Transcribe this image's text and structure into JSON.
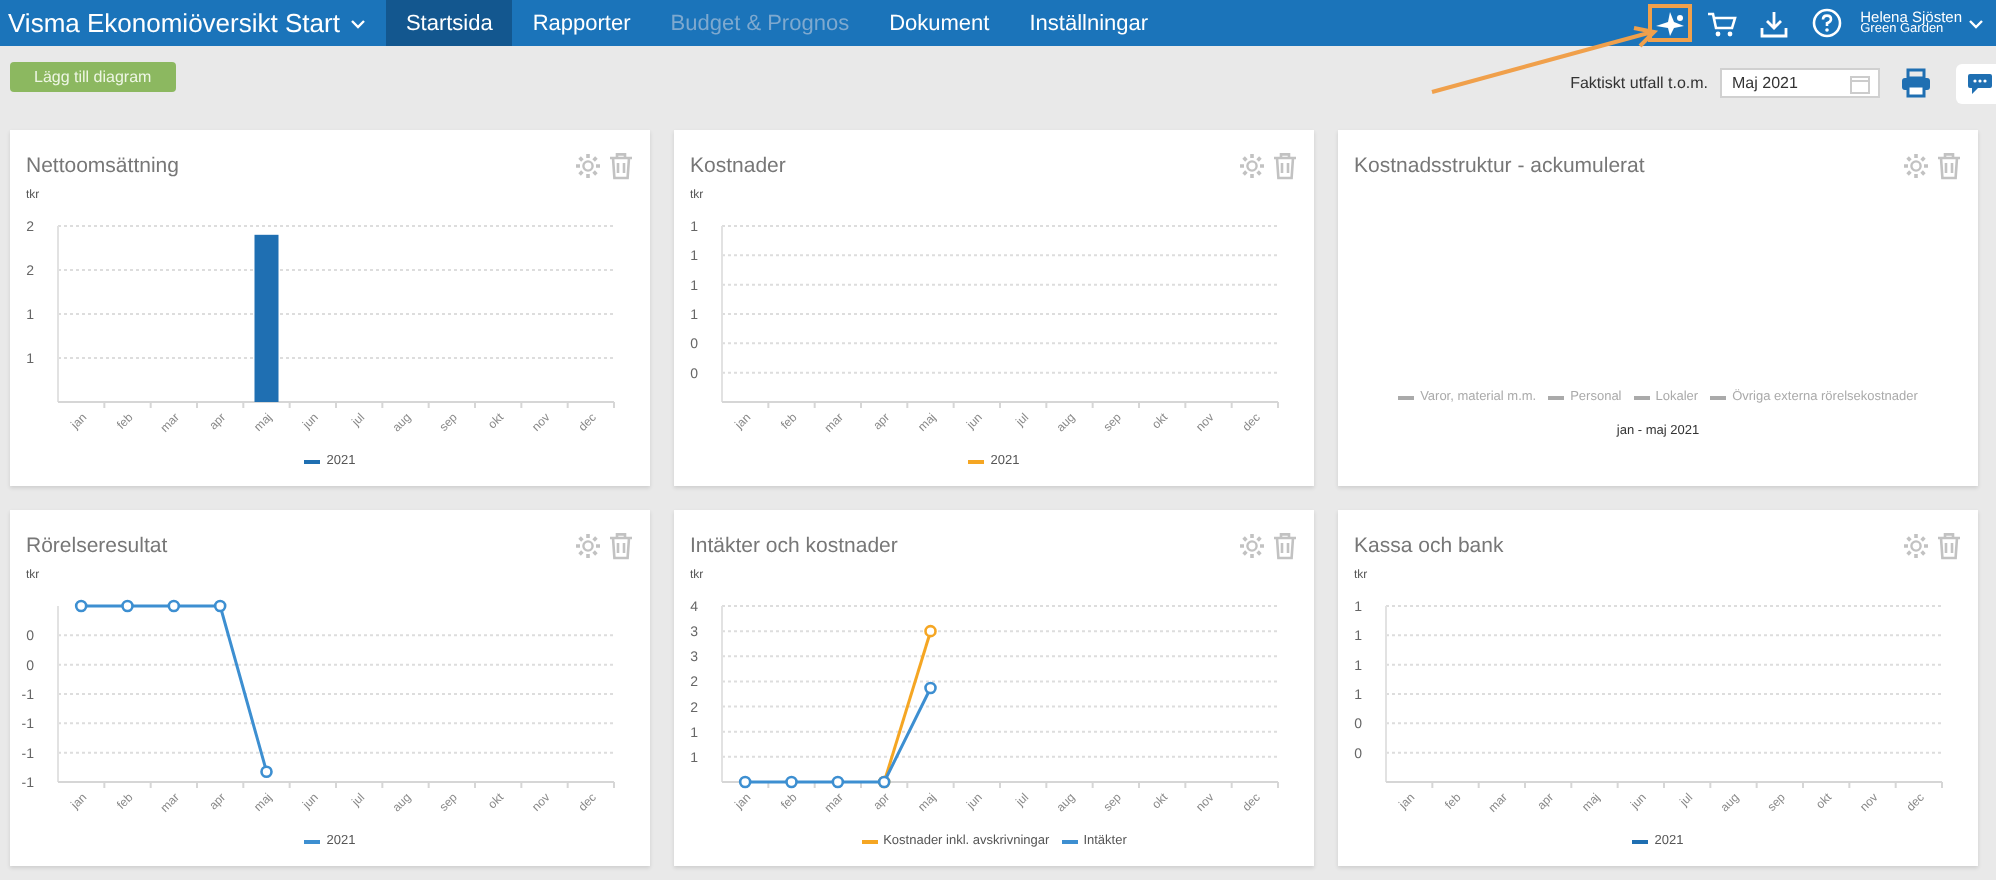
{
  "header": {
    "app_title": "Visma Ekonomiöversikt Start",
    "tabs": [
      {
        "label": "Startsida",
        "selected": true,
        "disabled": false
      },
      {
        "label": "Rapporter",
        "selected": false,
        "disabled": false
      },
      {
        "label": "Budget & Prognos",
        "selected": false,
        "disabled": true
      },
      {
        "label": "Dokument",
        "selected": false,
        "disabled": false
      },
      {
        "label": "Inställningar",
        "selected": false,
        "disabled": false
      }
    ],
    "icons": [
      {
        "kind": "tour",
        "highlighted": true
      },
      {
        "kind": "cart",
        "highlighted": false
      },
      {
        "kind": "download",
        "highlighted": false
      },
      {
        "kind": "help",
        "highlighted": false
      }
    ],
    "user": {
      "name": "Helena Sjösten",
      "company": "Green Garden"
    }
  },
  "toolbar": {
    "add_button": "Lägg till diagram",
    "period_label": "Faktiskt utfall t.o.m.",
    "period_value": "Maj 2021"
  },
  "cards": [
    {
      "title": "Nettoomsättning",
      "kind": "chart",
      "chart_data": {
        "type": "bar",
        "grid": true,
        "ylabel": "tkr",
        "categories": [
          "jan",
          "feb",
          "mar",
          "apr",
          "maj",
          "jun",
          "jul",
          "aug",
          "sep",
          "okt",
          "nov",
          "dec"
        ],
        "ylim": [
          0,
          2
        ],
        "yticks": [
          {
            "value": 0.5,
            "label": "1"
          },
          {
            "value": 1,
            "label": "1"
          },
          {
            "value": 1.5,
            "label": "2"
          },
          {
            "value": 2,
            "label": "2"
          }
        ],
        "series": [
          {
            "name": "2021",
            "color": "#1f6fb2",
            "values": [
              null,
              null,
              null,
              null,
              1.9,
              null,
              null,
              null,
              null,
              null,
              null,
              null
            ]
          }
        ]
      }
    },
    {
      "title": "Kostnader",
      "kind": "chart",
      "chart_data": {
        "type": "line",
        "grid": true,
        "ylabel": "tkr",
        "categories": [
          "jan",
          "feb",
          "mar",
          "apr",
          "maj",
          "jun",
          "jul",
          "aug",
          "sep",
          "okt",
          "nov",
          "dec"
        ],
        "ylim": [
          0,
          1.2
        ],
        "yticks": [
          {
            "value": 0.2,
            "label": "0"
          },
          {
            "value": 0.4,
            "label": "0"
          },
          {
            "value": 0.6,
            "label": "1"
          },
          {
            "value": 0.8,
            "label": "1"
          },
          {
            "value": 1,
            "label": "1"
          },
          {
            "value": 1.2,
            "label": "1"
          }
        ],
        "series": [
          {
            "name": "2021",
            "color": "#f5a623",
            "values": [
              null,
              null,
              null,
              null,
              null,
              null,
              null,
              null,
              null,
              null,
              null,
              null
            ]
          }
        ]
      }
    },
    {
      "title": "Kostnadsstruktur - ackumulerat",
      "kind": "legend_only",
      "legend": [
        "Varor, material m.m.",
        "Personal",
        "Lokaler",
        "Övriga externa rörelsekostnader"
      ],
      "period": "jan - maj 2021"
    },
    {
      "title": "Rörelseresultat",
      "kind": "chart",
      "chart_data": {
        "type": "line",
        "grid": true,
        "ylabel": "tkr",
        "categories": [
          "jan",
          "feb",
          "mar",
          "apr",
          "maj",
          "jun",
          "jul",
          "aug",
          "sep",
          "okt",
          "nov",
          "dec"
        ],
        "ylim": [
          -1.2,
          0
        ],
        "yticks": [
          {
            "value": -1.2,
            "label": "-1"
          },
          {
            "value": -1,
            "label": "-1"
          },
          {
            "value": -0.8,
            "label": "-1"
          },
          {
            "value": -0.6,
            "label": "-1"
          },
          {
            "value": -0.4,
            "label": "0"
          },
          {
            "value": -0.2,
            "label": "0"
          }
        ],
        "series": [
          {
            "name": "2021",
            "color": "#3d8fd1",
            "marker": true,
            "values": [
              0,
              0,
              0,
              0,
              -1.13,
              null,
              null,
              null,
              null,
              null,
              null,
              null
            ]
          }
        ]
      }
    },
    {
      "title": "Intäkter och kostnader",
      "kind": "chart",
      "chart_data": {
        "type": "line",
        "grid": true,
        "ylabel": "tkr",
        "categories": [
          "jan",
          "feb",
          "mar",
          "apr",
          "maj",
          "jun",
          "jul",
          "aug",
          "sep",
          "okt",
          "nov",
          "dec"
        ],
        "ylim": [
          0,
          3.5
        ],
        "yticks": [
          {
            "value": 0.5,
            "label": "1"
          },
          {
            "value": 1,
            "label": "1"
          },
          {
            "value": 1.5,
            "label": "2"
          },
          {
            "value": 2,
            "label": "2"
          },
          {
            "value": 2.5,
            "label": "3"
          },
          {
            "value": 3,
            "label": "3"
          },
          {
            "value": 3.5,
            "label": "4"
          }
        ],
        "series": [
          {
            "name": "Kostnader inkl. avskrivningar",
            "color": "#f5a623",
            "marker": true,
            "values": [
              null,
              null,
              null,
              0,
              3,
              null,
              null,
              null,
              null,
              null,
              null,
              null
            ]
          },
          {
            "name": "Intäkter",
            "color": "#3d8fd1",
            "marker": true,
            "values": [
              0,
              0,
              0,
              0,
              1.87,
              null,
              null,
              null,
              null,
              null,
              null,
              null
            ]
          }
        ]
      }
    },
    {
      "title": "Kassa och bank",
      "kind": "chart",
      "chart_data": {
        "type": "line",
        "grid": true,
        "ylabel": "tkr",
        "categories": [
          "jan",
          "feb",
          "mar",
          "apr",
          "maj",
          "jun",
          "jul",
          "aug",
          "sep",
          "okt",
          "nov",
          "dec"
        ],
        "ylim": [
          0,
          1.2
        ],
        "yticks": [
          {
            "value": 0.2,
            "label": "0"
          },
          {
            "value": 0.4,
            "label": "0"
          },
          {
            "value": 0.6,
            "label": "1"
          },
          {
            "value": 0.8,
            "label": "1"
          },
          {
            "value": 1,
            "label": "1"
          },
          {
            "value": 1.2,
            "label": "1"
          }
        ],
        "series": [
          {
            "name": "2021",
            "color": "#1f6fb2",
            "values": [
              null,
              null,
              null,
              null,
              null,
              null,
              null,
              null,
              null,
              null,
              null,
              null
            ]
          }
        ]
      }
    }
  ]
}
